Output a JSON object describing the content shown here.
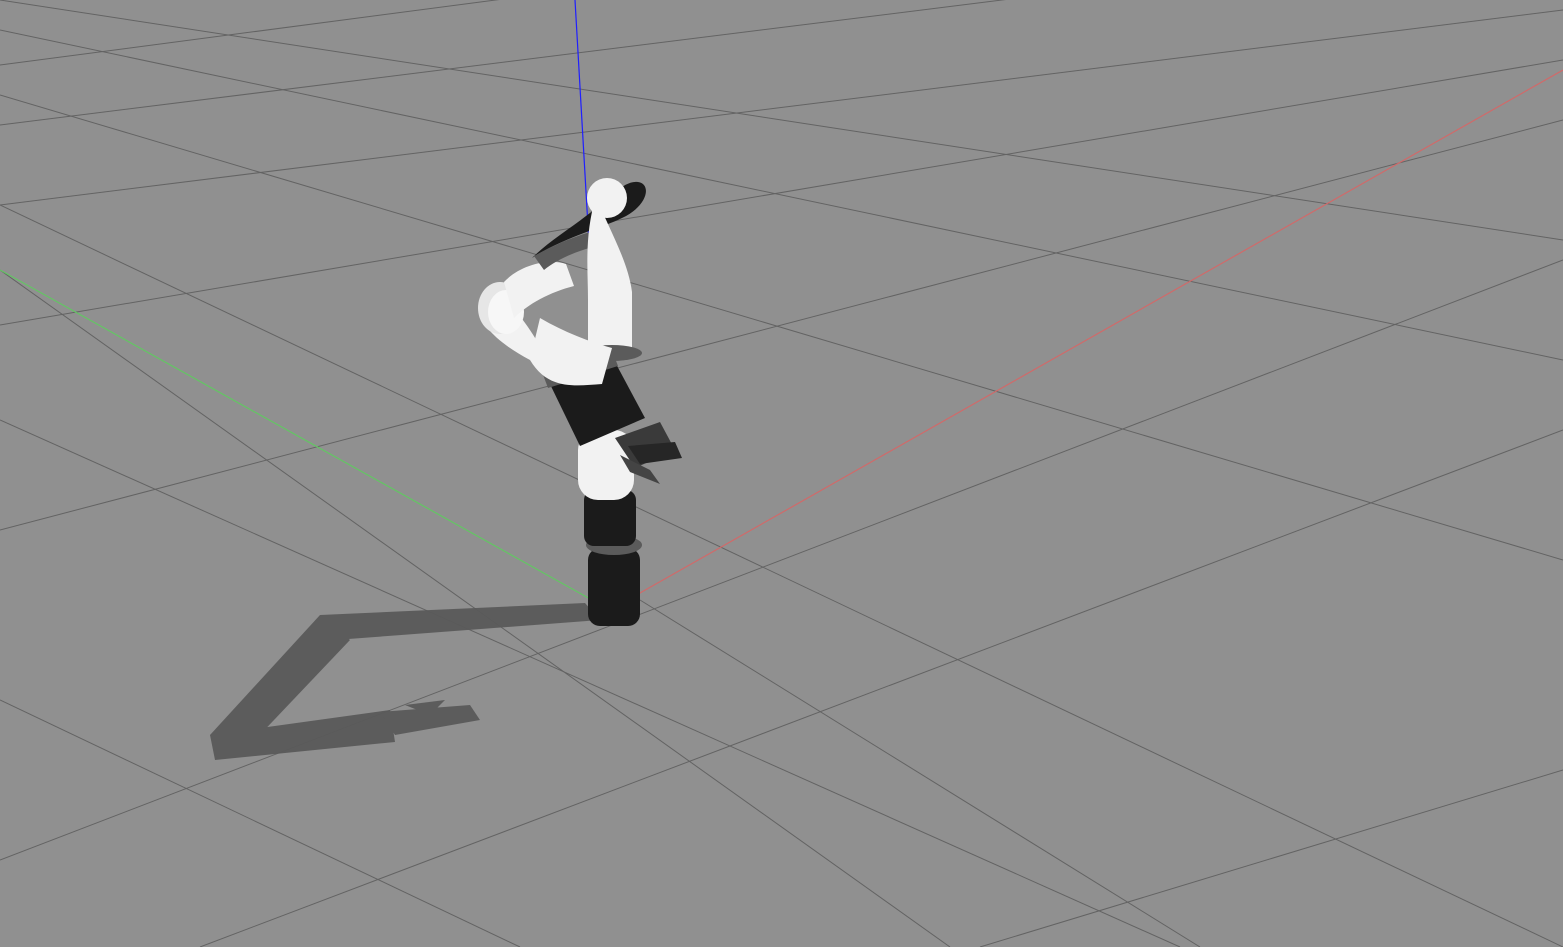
{
  "scene": {
    "background_color": "#909090",
    "grid_line_color": "#5f5f5f",
    "axis_colors": {
      "x_axis": "#d06a6a",
      "y_axis": "#63c663",
      "z_axis": "#1f1fff"
    },
    "robot": {
      "description_icon": "robot-arm-icon",
      "link_colors": {
        "white": "#f2f2f2",
        "black": "#1b1b1b",
        "ring": "#5b5b5b"
      }
    },
    "shadow_color": "#5a5a5a"
  }
}
